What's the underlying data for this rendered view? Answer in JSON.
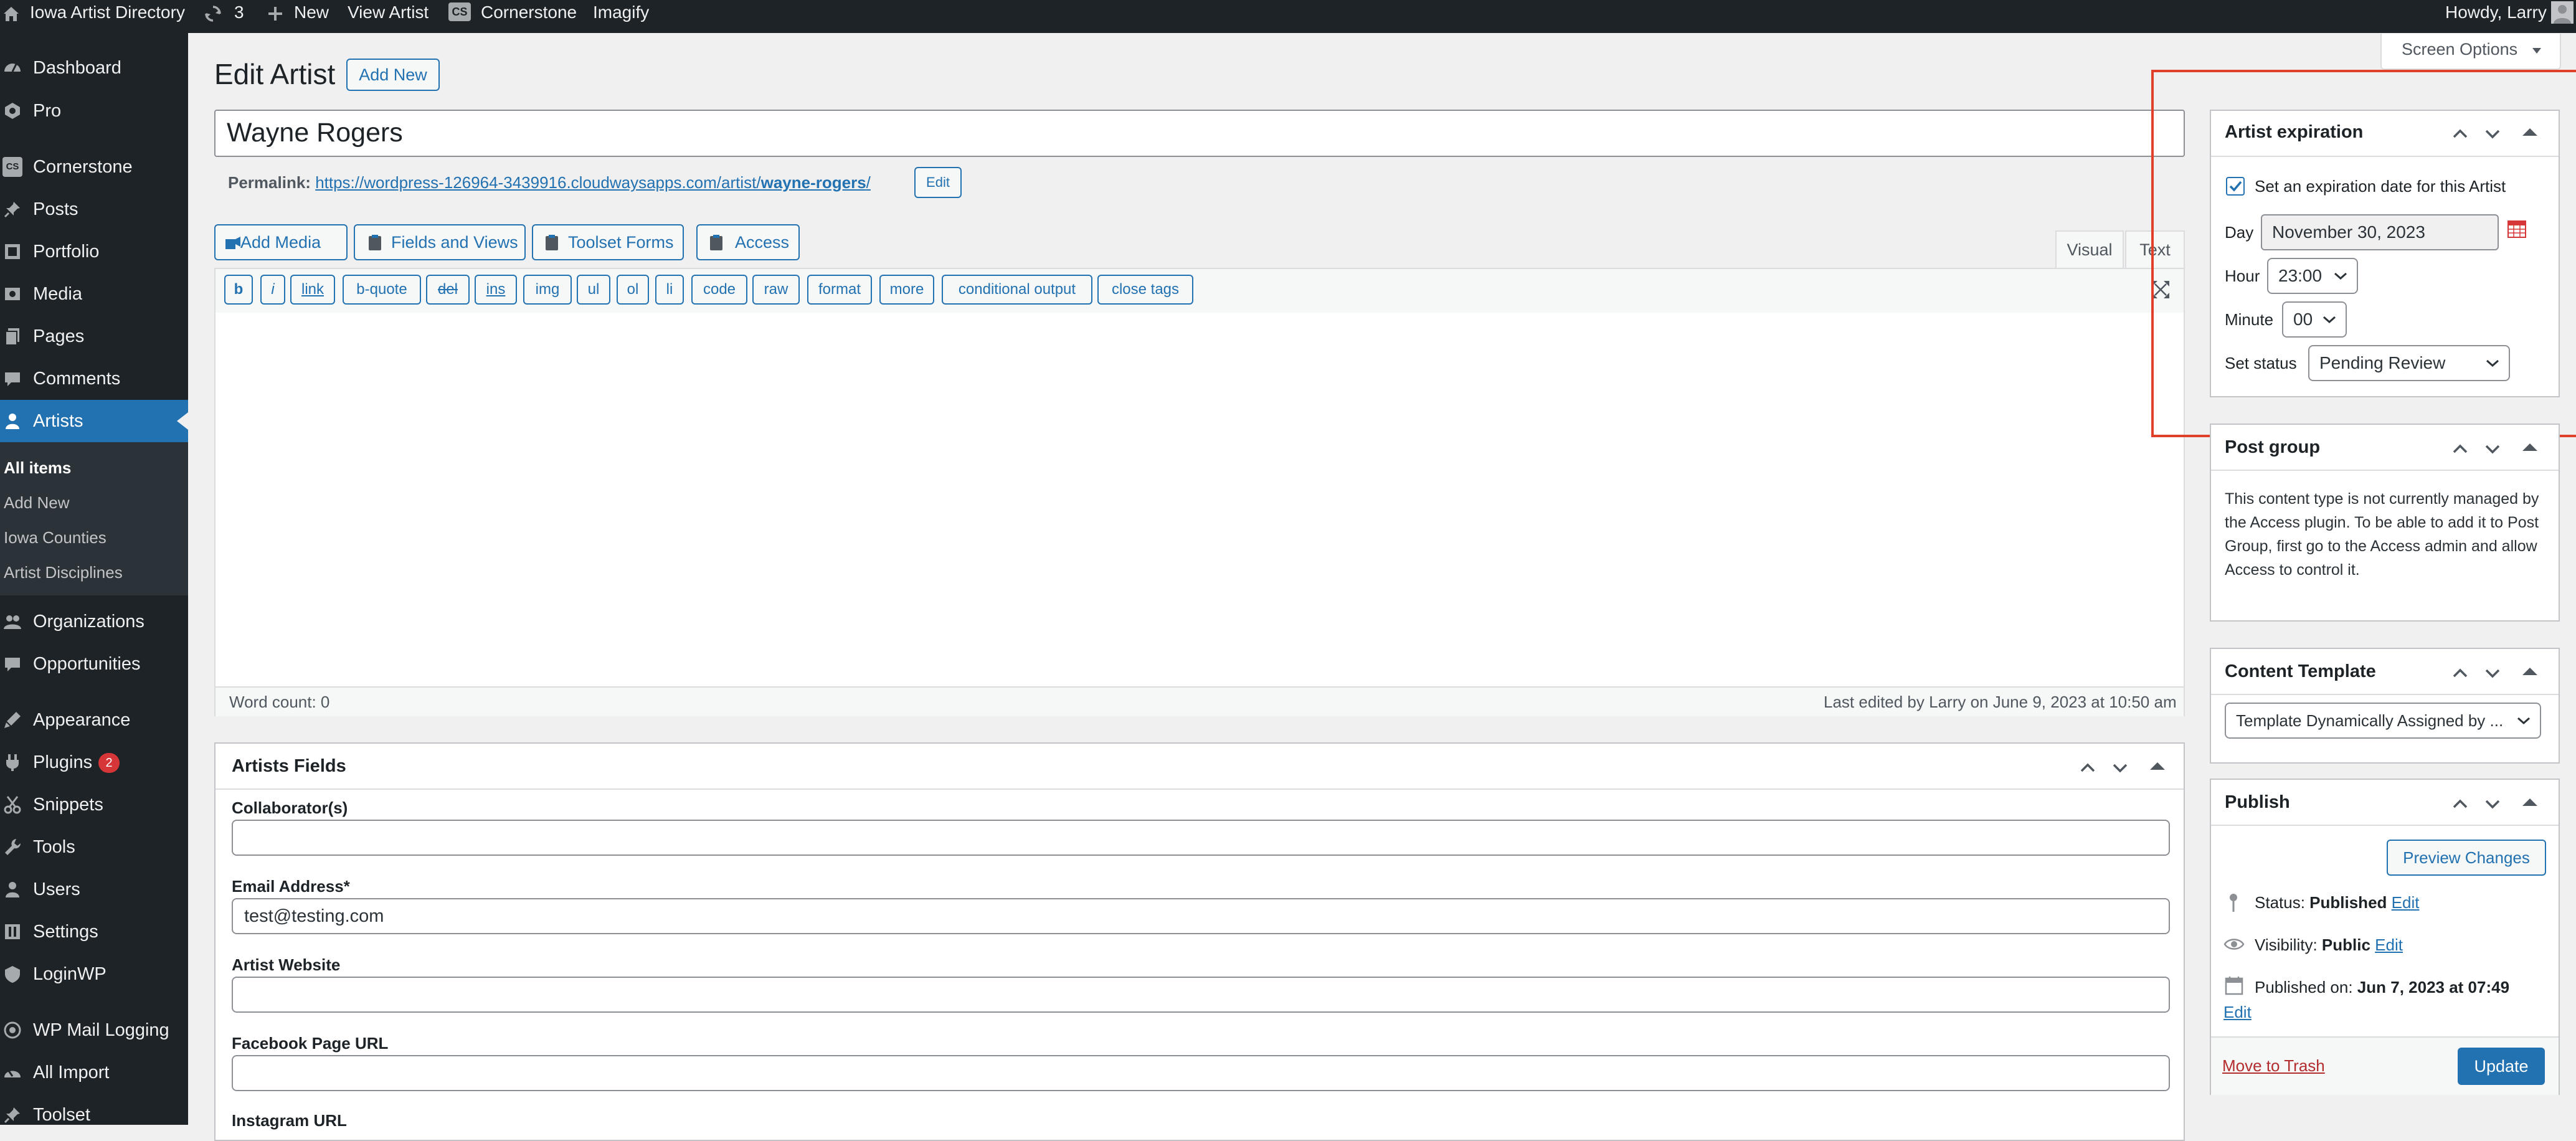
{
  "admin_bar": {
    "site_name": "Iowa Artist Directory",
    "updates_count": "3",
    "new_label": "New",
    "view_label": "View Artist",
    "cornerstone_label": "Cornerstone",
    "cs_badge": "CS",
    "imagify_label": "Imagify",
    "howdy": "Howdy, Larry"
  },
  "sidebar": {
    "items": [
      {
        "label": "Dashboard",
        "icon": "dashboard-icon"
      },
      {
        "label": "Pro",
        "icon": "pro-icon"
      },
      {
        "label": "Cornerstone",
        "icon": "cornerstone-icon",
        "badge": "CS"
      },
      {
        "label": "Posts",
        "icon": "pin-icon"
      },
      {
        "label": "Portfolio",
        "icon": "portfolio-icon"
      },
      {
        "label": "Media",
        "icon": "media-icon"
      },
      {
        "label": "Pages",
        "icon": "pages-icon"
      },
      {
        "label": "Comments",
        "icon": "comments-icon"
      },
      {
        "label": "Artists",
        "icon": "user-icon"
      },
      {
        "label": "Organizations",
        "icon": "organizations-icon"
      },
      {
        "label": "Opportunities",
        "icon": "opportunities-icon"
      },
      {
        "label": "Appearance",
        "icon": "appearance-icon"
      },
      {
        "label": "Plugins",
        "icon": "plugins-icon",
        "badge": "2"
      },
      {
        "label": "Snippets",
        "icon": "snippets-icon"
      },
      {
        "label": "Tools",
        "icon": "tools-icon"
      },
      {
        "label": "Users",
        "icon": "users-icon"
      },
      {
        "label": "Settings",
        "icon": "settings-icon"
      },
      {
        "label": "LoginWP",
        "icon": "loginwp-icon"
      },
      {
        "label": "WP Mail Logging",
        "icon": "mail-logging-icon"
      },
      {
        "label": "All Import",
        "icon": "all-import-icon"
      },
      {
        "label": "Toolset",
        "icon": "toolset-icon"
      }
    ],
    "submenu": [
      "All items",
      "Add New",
      "Iowa Counties",
      "Artist Disciplines"
    ]
  },
  "screen_options": "Screen Options",
  "page_title": "Edit Artist",
  "add_new": "Add New",
  "post_title": "Wayne Rogers",
  "permalink": {
    "label": "Permalink:",
    "base": "https://wordpress-126964-3439916.cloudwaysapps.com/artist/",
    "slug": "wayne-rogers",
    "trail": "/",
    "edit": "Edit"
  },
  "media_buttons": [
    "Add Media",
    "Fields and Views",
    "Toolset Forms",
    "Access"
  ],
  "editor_tabs": {
    "visual": "Visual",
    "text": "Text"
  },
  "quicktags": [
    "b",
    "i",
    "link",
    "b-quote",
    "del",
    "ins",
    "img",
    "ul",
    "ol",
    "li",
    "code",
    "raw",
    "format",
    "more",
    "conditional output",
    "close tags"
  ],
  "status_bar": {
    "word_count": "Word count: 0",
    "last_edited": "Last edited by Larry on June 9, 2023 at 10:50 am"
  },
  "artists_fields": {
    "title": "Artists Fields",
    "fields": [
      {
        "label": "Collaborator(s)",
        "value": ""
      },
      {
        "label": "Email Address*",
        "value": "test@testing.com"
      },
      {
        "label": "Artist Website",
        "value": ""
      },
      {
        "label": "Facebook Page URL",
        "value": ""
      },
      {
        "label": "Instagram URL",
        "value": ""
      }
    ]
  },
  "expiration": {
    "title": "Artist expiration",
    "checkbox_label": "Set an expiration date for this Artist",
    "checked": true,
    "day_label": "Day",
    "day_value": "November 30, 2023",
    "hour_label": "Hour",
    "hour_value": "23:00",
    "minute_label": "Minute",
    "minute_value": "00",
    "status_label": "Set status",
    "status_value": "Pending Review"
  },
  "post_group": {
    "title": "Post group",
    "text": "This content type is not currently managed by the Access plugin. To be able to add it to Post Group, first go to the Access admin and allow Access to control it."
  },
  "content_template": {
    "title": "Content Template",
    "value": "Template Dynamically Assigned by ..."
  },
  "publish": {
    "title": "Publish",
    "preview": "Preview Changes",
    "status_label": "Status:",
    "status_value": "Published",
    "visibility_label": "Visibility:",
    "visibility_value": "Public",
    "published_label": "Published on:",
    "published_value": "Jun 7, 2023 at 07:49",
    "edit": "Edit",
    "trash": "Move to Trash",
    "update": "Update"
  },
  "colors": {
    "admin_bg": "#1d2327",
    "accent": "#2271b1",
    "highlight_box": "#e0402a",
    "badge": "#d63638"
  }
}
